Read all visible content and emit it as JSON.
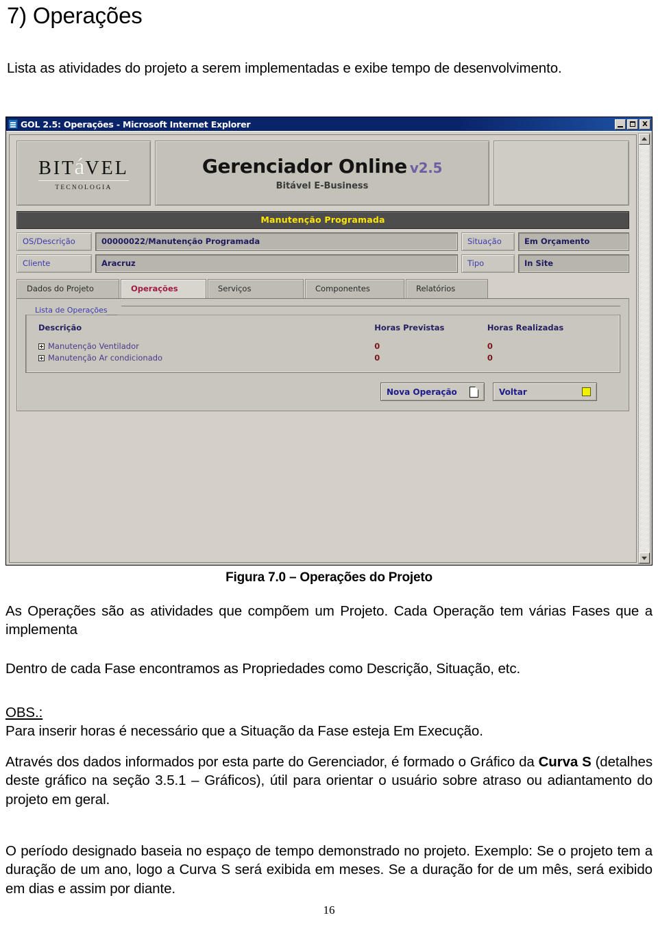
{
  "document": {
    "heading": "7) Operações",
    "intro": "Lista as atividades do projeto a serem implementadas e exibe tempo de desenvolvimento.",
    "figure_caption": "Figura 7.0 – Operações do Projeto",
    "paragraph_1": "As Operações são as atividades que compõem um Projeto. Cada Operação tem várias Fases que a implementa",
    "paragraph_2": "Dentro de cada Fase encontramos as Propriedades como Descrição, Situação, etc.",
    "obs_label": "OBS.:",
    "obs_text": "Para inserir horas é necessário que a Situação da Fase esteja Em Execução.",
    "paragraph_3_part1": "Através dos dados informados por esta parte do Gerenciador, é formado o Gráfico da ",
    "paragraph_3_bold": "Curva S",
    "paragraph_3_part2": " (detalhes deste gráfico na seção 3.5.1 – Gráficos), útil para orientar o usuário sobre atraso ou adiantamento do projeto em geral.",
    "paragraph_4": "O período designado baseia no espaço de tempo demonstrado no projeto. Exemplo: Se o projeto tem a duração de um ano, logo a Curva S será exibida em meses. Se a duração for de um mês, será exibido em dias e assim por diante.",
    "page_number": "16"
  },
  "browser": {
    "window_title": "GOL 2.5: Operações - Microsoft Internet Explorer",
    "app_icon": "internet-explorer-icon",
    "controls": {
      "minimize": "minimize-icon",
      "maximize": "maximize-icon",
      "close": "X"
    },
    "scrollbar": {
      "up_arrow": "scroll-up-icon",
      "down_arrow": "scroll-down-icon"
    }
  },
  "app": {
    "logo": {
      "word_before": "BIT",
      "accent": "á",
      "word_after": "VEL",
      "subtitle": "TECNOLOGIA"
    },
    "banner": {
      "title": "Gerenciador Online",
      "version": "v2.5",
      "subtitle": "Bitável E-Business",
      "version_color": "#6e5fa5"
    },
    "record_title": "Manutenção Programada",
    "record_title_color": "#ffe600",
    "fields": [
      {
        "label": "OS/Descrição",
        "value": "00000022/Manutenção Programada"
      },
      {
        "label": "Situação",
        "value": "Em Orçamento"
      },
      {
        "label": "Cliente",
        "value": "Aracruz"
      },
      {
        "label": "Tipo",
        "value": "In Site"
      }
    ],
    "tabs": [
      {
        "label": "Dados do Projeto",
        "active": false
      },
      {
        "label": "Operações",
        "active": true
      },
      {
        "label": "Serviços",
        "active": false
      },
      {
        "label": "Componentes",
        "active": false
      },
      {
        "label": "Relatórios",
        "active": false
      }
    ],
    "active_tab_color": "#a01b44",
    "list": {
      "legend": "Lista de Operações",
      "columns": [
        "Descrição",
        "Horas Previstas",
        "Horas Realizadas"
      ],
      "rows": [
        {
          "expand_icon": "plus-box-icon",
          "descricao": "Manutenção Ventilador",
          "horas_previstas": "0",
          "horas_realizadas": "0"
        },
        {
          "expand_icon": "plus-box-icon",
          "descricao": "Manutenção Ar condicionado",
          "horas_previstas": "0",
          "horas_realizadas": "0"
        }
      ]
    },
    "buttons": [
      {
        "label": "Nova Operação",
        "icon": "document-page-icon"
      },
      {
        "label": "Voltar",
        "icon": "yellow-square-icon"
      }
    ]
  }
}
